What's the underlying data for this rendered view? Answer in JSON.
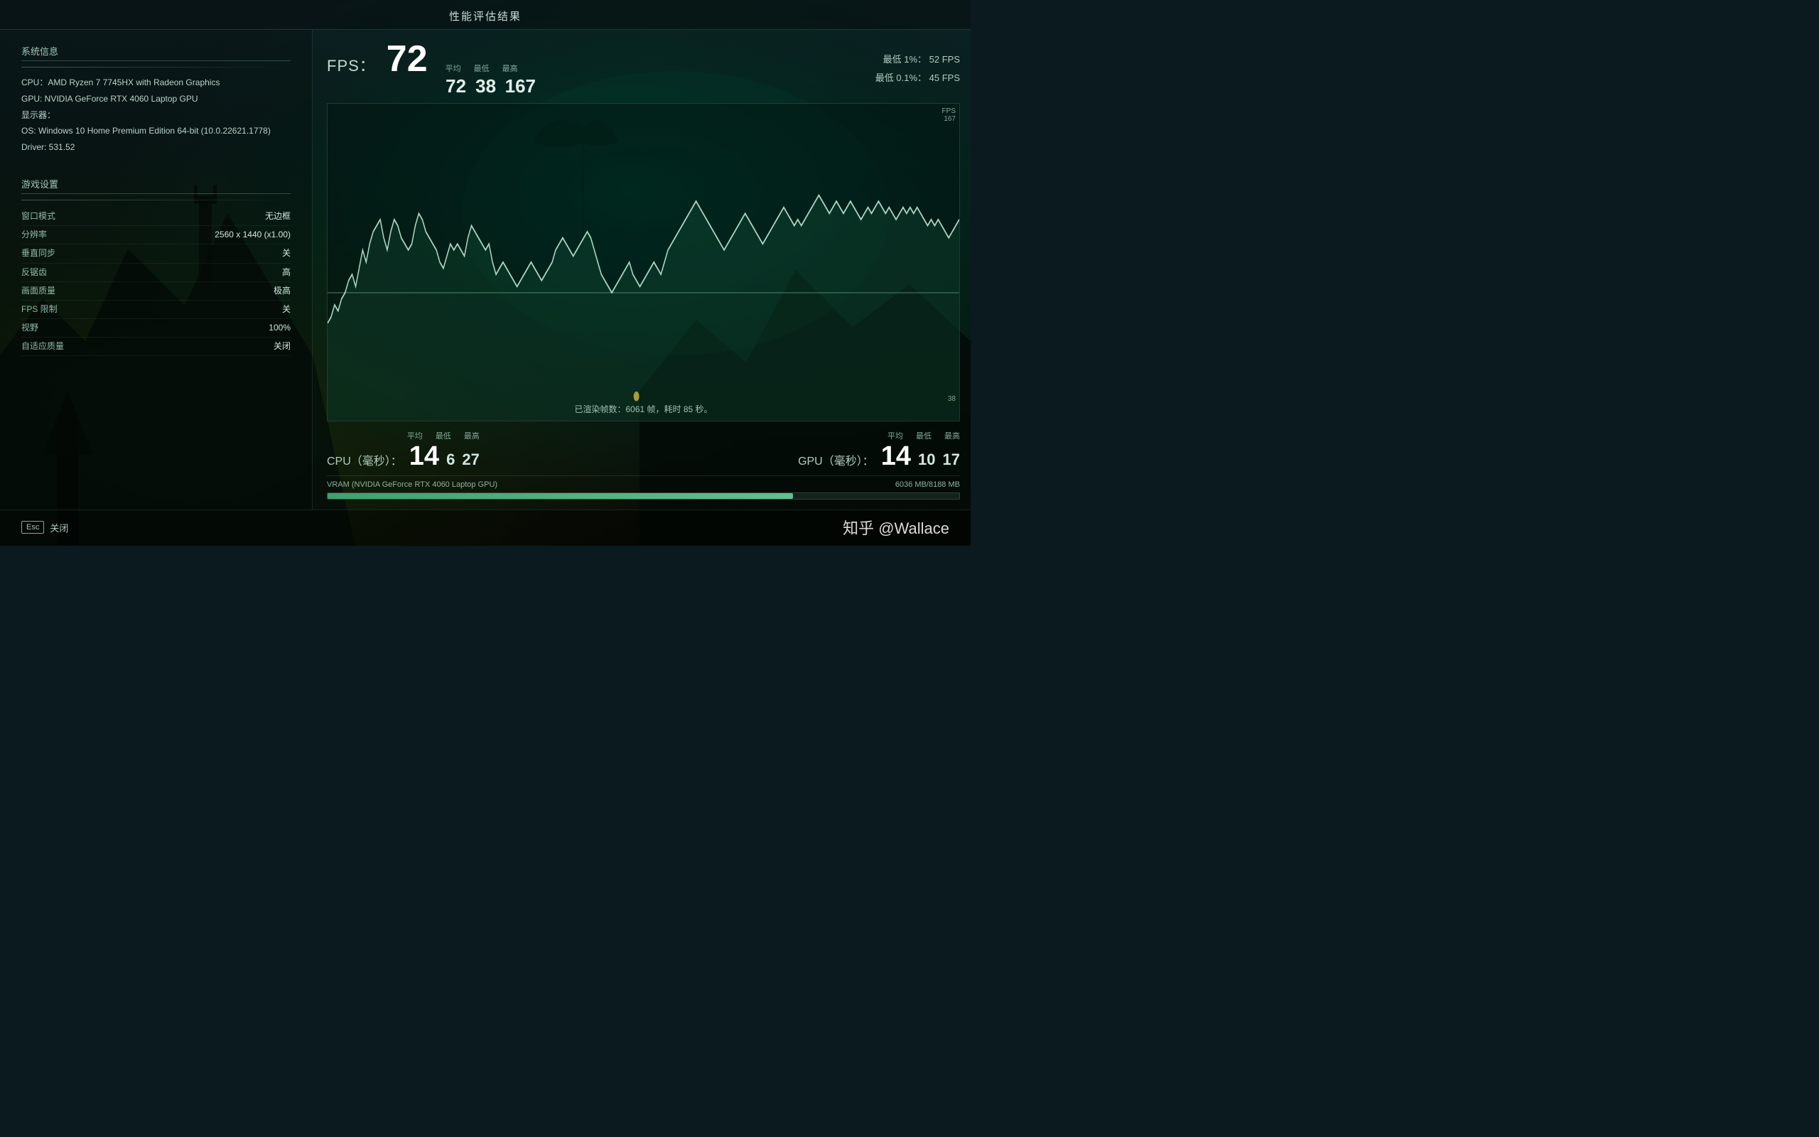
{
  "title": "性能评估结果",
  "system": {
    "section_label": "系统信息",
    "cpu": "CPU：AMD Ryzen 7 7745HX with Radeon Graphics",
    "gpu": "GPU: NVIDIA GeForce RTX 4060 Laptop GPU",
    "display": "显示器：",
    "os": "OS: Windows 10 Home Premium Edition 64-bit (10.0.22621.1778)",
    "driver": "Driver: 531.52"
  },
  "game_settings": {
    "section_label": "游戏设置",
    "rows": [
      {
        "label": "窗口模式",
        "value": "无边框"
      },
      {
        "label": "分辨率",
        "value": "2560 x 1440 (x1.00)"
      },
      {
        "label": "垂直同步",
        "value": "关"
      },
      {
        "label": "反锯齿",
        "value": "高"
      },
      {
        "label": "画面质量",
        "value": "极高"
      },
      {
        "label": "FPS 限制",
        "value": "关"
      },
      {
        "label": "视野",
        "value": "100%"
      },
      {
        "label": "自适应质量",
        "value": "关闭"
      }
    ]
  },
  "fps": {
    "label": "FPS：",
    "avg_label": "平均",
    "min_label": "最低",
    "max_label": "最高",
    "avg": "72",
    "min": "38",
    "max": "167",
    "low1_label": "最低 1%：",
    "low1_value": "52 FPS",
    "low01_label": "最低 0.1%：",
    "low01_value": "45 FPS",
    "chart_fps_label": "FPS",
    "chart_max": "167",
    "chart_min": "38"
  },
  "render_info": {
    "text": "已渲染帧数：6061 帧，耗时 85 秒。"
  },
  "cpu": {
    "label": "CPU（毫秒）：",
    "avg_label": "平均",
    "min_label": "最低",
    "max_label": "最高",
    "avg": "14",
    "min": "6",
    "max": "27"
  },
  "gpu": {
    "label": "GPU（毫秒）：",
    "avg_label": "平均",
    "min_label": "最低",
    "max_label": "最高",
    "avg": "14",
    "min": "10",
    "max": "17"
  },
  "vram": {
    "label": "VRAM (NVIDIA GeForce RTX 4060 Laptop GPU)",
    "used": "6036 MB",
    "total": "8188 MB",
    "display": "6036 MB/8188 MB",
    "fill_pct": 73.7
  },
  "footer": {
    "esc_label": "Esc",
    "close_label": "关闭",
    "watermark": "知乎 @Wallace"
  }
}
